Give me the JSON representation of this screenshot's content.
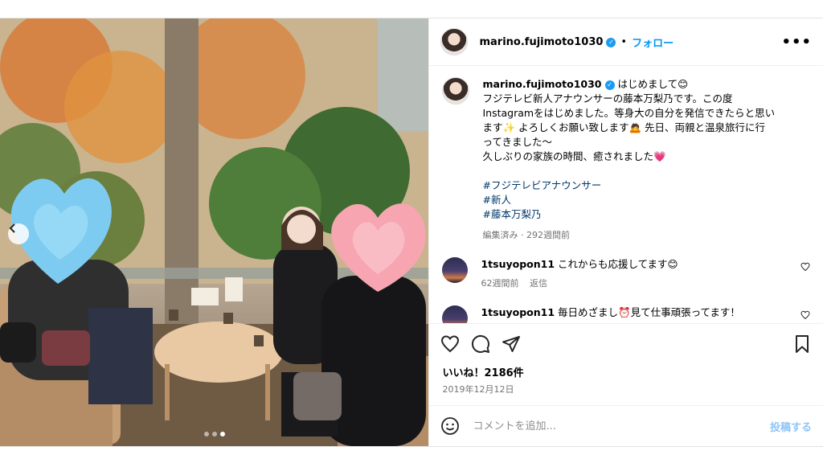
{
  "post": {
    "username": "marino.fujimoto1030",
    "separator": "•",
    "follow_label": "フォロー",
    "more_label": "•••",
    "caption": {
      "lines": [
        "はじめまして😊",
        "フジテレビ新人アナウンサーの藤本万梨乃です。この度",
        "Instagramをはじめました。等身大の自分を発信できたらと思い",
        "ます✨ よろしくお願い致します🙇 先日、両親と温泉旅行に行",
        "ってきました〜",
        "久しぶりの家族の時間、癒されました💗"
      ],
      "hashtags": [
        "#フジテレビアナウンサー",
        "#新人",
        "#藤本万梨乃"
      ],
      "meta": "編集済み · 292週間前"
    },
    "comments": [
      {
        "username": "1tsuyopon11",
        "text": "これからも応援してます😊",
        "time": "62週間前",
        "reply_label": "返信"
      },
      {
        "username": "1tsuyopon11",
        "text": "毎日めざまし⏰見て仕事頑張ってます！",
        "time": "",
        "reply_label": ""
      }
    ],
    "likes": "いいね！2186件",
    "date": "2019年12月12日",
    "comment_placeholder": "コメントを追加...",
    "post_label": "投稿する"
  },
  "icons": {
    "prev": "chevron-left-icon",
    "like": "heart-icon",
    "comment": "comment-icon",
    "share": "send-icon",
    "save": "bookmark-icon",
    "emoji": "emoji-icon",
    "verified": "verified-badge-icon"
  },
  "carousel": {
    "slides": 3,
    "active": 3
  },
  "colors": {
    "accent": "#0095f6",
    "verified": "#1d9bf0",
    "link": "#00376b",
    "muted": "#737373"
  }
}
